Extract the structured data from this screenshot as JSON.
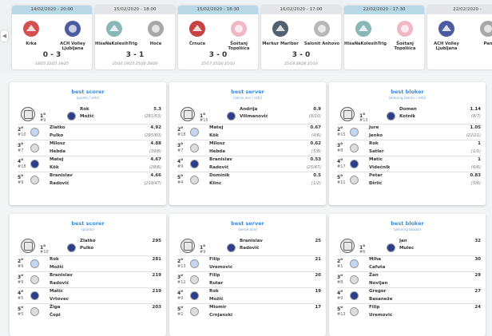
{
  "matches": [
    {
      "date": "14/02/2020 - 20:00",
      "active": true,
      "home": "Krka",
      "away": "ACH Volley Ljubljana",
      "score": "0 - 3",
      "sets": "18/25 22/25 19/25"
    },
    {
      "date": "15/02/2020 - 18:00",
      "active": false,
      "home": "HišaNaKolesihTrig",
      "away": "Hoče",
      "score": "3 - 1",
      "sets": "25/16 19/25 25/20 28/26"
    },
    {
      "date": "15/02/2020 - 18:30",
      "active": true,
      "home": "Črnuče",
      "away": "Šoštanj Topolšica",
      "score": "3 - 0",
      "sets": "25/17 25/20 25/10"
    },
    {
      "date": "16/02/2020 - 17:00",
      "active": false,
      "home": "Merkur Maribor",
      "away": "Salonit Anhovo",
      "score": "3 - 0",
      "sets": "25/14 28/26 25/16"
    },
    {
      "date": "22/02/2020 - 17:30",
      "active": true,
      "home": "HišaNaKolesihTrig",
      "away": "Šoštanj Topolšica",
      "score": "",
      "sets": ""
    },
    {
      "date": "22/02/2020 -",
      "active": false,
      "home": "ACH Volley Ljubljana",
      "away": "Pan",
      "score": "",
      "sets": ""
    }
  ],
  "panels": [
    {
      "title": "best scorer",
      "subtitle": "(points / sets)",
      "rows": [
        {
          "rank": "1",
          "num": "#9",
          "first": "Rok",
          "last": "Možič",
          "val": "5.3",
          "sub": "(281/53)"
        },
        {
          "rank": "2",
          "num": "#10",
          "first": "Zlatko",
          "last": "Pulko",
          "val": "4.92",
          "sub": "(295/60)"
        },
        {
          "rank": "3",
          "num": "#7",
          "first": "Milosz",
          "last": "Hebda",
          "val": "4.88",
          "sub": "(39/8)"
        },
        {
          "rank": "4",
          "num": "#18",
          "first": "Matej",
          "last": "Kök",
          "val": "4.67",
          "sub": "(28/6)"
        },
        {
          "rank": "5",
          "num": "#9",
          "first": "Branislav",
          "last": "Radovič",
          "val": "4.66",
          "sub": "(219/47)"
        }
      ]
    },
    {
      "title": "best server",
      "subtitle": "(serve ace / sets)",
      "rows": [
        {
          "rank": "1",
          "num": "#15",
          "first": "Andrija",
          "last": "Vilimanović",
          "val": "0.9",
          "sub": "(9/10)"
        },
        {
          "rank": "2",
          "num": "#18",
          "first": "Matej",
          "last": "Kök",
          "val": "0.67",
          "sub": "(4/6)"
        },
        {
          "rank": "3",
          "num": "#7",
          "first": "Milosz",
          "last": "Hebda",
          "val": "0.62",
          "sub": "(5/8)"
        },
        {
          "rank": "4",
          "num": "#9",
          "first": "Branislav",
          "last": "Radovič",
          "val": "0.53",
          "sub": "(25/47)"
        },
        {
          "rank": "5",
          "num": "#4",
          "first": "Dominik",
          "last": "Klinc",
          "val": "0.5",
          "sub": "(1/2)"
        }
      ]
    },
    {
      "title": "best bloker",
      "subtitle": "(winning blocks / sets)",
      "rows": [
        {
          "rank": "1",
          "num": "#13",
          "first": "Domen",
          "last": "Kotnik",
          "val": "1.14",
          "sub": "(8/7)"
        },
        {
          "rank": "2",
          "num": "#15",
          "first": "Jure",
          "last": "Jenko",
          "val": "1.05",
          "sub": "(22/21)"
        },
        {
          "rank": "3",
          "num": "#8",
          "first": "Rok",
          "last": "Satler",
          "val": "1",
          "sub": "(1/1)"
        },
        {
          "rank": "4",
          "num": "#17",
          "first": "Matic",
          "last": "Videčnik",
          "val": "1",
          "sub": "(6/6)"
        },
        {
          "rank": "5",
          "num": "#11",
          "first": "Petar",
          "last": "Đirlić",
          "val": "0.83",
          "sub": "(5/6)"
        }
      ]
    },
    {
      "title": "best scorer",
      "subtitle": "(points)",
      "rows": [
        {
          "rank": "1",
          "num": "#10",
          "first": "Zlatko",
          "last": "Pulko",
          "val": "295",
          "sub": ""
        },
        {
          "rank": "2",
          "num": "#9",
          "first": "Rok",
          "last": "Možič",
          "val": "281",
          "sub": ""
        },
        {
          "rank": "3",
          "num": "#9",
          "first": "Branislav",
          "last": "Radovič",
          "val": "219",
          "sub": ""
        },
        {
          "rank": "4",
          "num": "#5",
          "first": "Matic",
          "last": "Vrtovec",
          "val": "219",
          "sub": ""
        },
        {
          "rank": "5",
          "num": "#5",
          "first": "Žiga",
          "last": "Čopi",
          "val": "203",
          "sub": ""
        }
      ]
    },
    {
      "title": "best server",
      "subtitle": "(serve ace)",
      "rows": [
        {
          "rank": "1",
          "num": "#9",
          "first": "Branislav",
          "last": "Radovič",
          "val": "25",
          "sub": ""
        },
        {
          "rank": "2",
          "num": "#13",
          "first": "Filip",
          "last": "Uremović",
          "val": "21",
          "sub": ""
        },
        {
          "rank": "3",
          "num": "#12",
          "first": "Filip",
          "last": "Rutar",
          "val": "20",
          "sub": ""
        },
        {
          "rank": "4",
          "num": "#9",
          "first": "Rok",
          "last": "Možič",
          "val": "19",
          "sub": ""
        },
        {
          "rank": "5",
          "num": "#2",
          "first": "Miomir",
          "last": "Crnjanski",
          "val": "17",
          "sub": ""
        }
      ]
    },
    {
      "title": "best bloker",
      "subtitle": "(winning blocks)",
      "rows": [
        {
          "rank": "1",
          "num": "#6",
          "first": "Jan",
          "last": "Mulec",
          "val": "32",
          "sub": ""
        },
        {
          "rank": "2",
          "num": "#1",
          "first": "Miha",
          "last": "Cafuta",
          "val": "30",
          "sub": ""
        },
        {
          "rank": "3",
          "num": "#8",
          "first": "Žan",
          "last": "Novljan",
          "val": "29",
          "sub": ""
        },
        {
          "rank": "4",
          "num": "#9",
          "first": "Gregor",
          "last": "Basaneže",
          "val": "27",
          "sub": ""
        },
        {
          "rank": "5",
          "num": "#13",
          "first": "Filip",
          "last": "Uremović",
          "val": "24",
          "sub": ""
        }
      ]
    }
  ],
  "icons": {
    "prev": "chevron-left-icon",
    "next": "chevron-right-icon",
    "player": "player-placeholder-icon",
    "team": "team-logo-icon"
  },
  "colors": {
    "active_header": "#b8d8e6",
    "inactive_header": "#e4e6e9",
    "title_blue": "#3b8ad8"
  }
}
